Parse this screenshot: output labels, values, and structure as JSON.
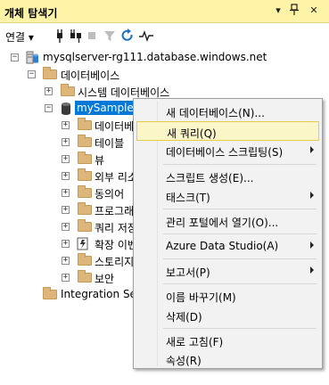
{
  "window": {
    "title": "개체 탐색기",
    "pin_glyph": "▾",
    "autohide_glyph": "ᚆ",
    "close_glyph": "✕"
  },
  "toolbar": {
    "connect_label": "연결",
    "tools": [
      "connect-plug-icon",
      "disconnect-plug-icon",
      "stop-icon",
      "filter-icon",
      "refresh-icon",
      "activity-monitor-icon"
    ]
  },
  "tree": {
    "server": "mysqlserver-rg111.database.windows.net",
    "databases_folder": "데이터베이스",
    "system_databases": "시스템 데이터베이스",
    "selected_db": "mySampleD",
    "children": [
      "데이터베이",
      "테이블",
      "뷰",
      "외부 리소",
      "동의어",
      "프로그래밍",
      "쿼리 저장",
      "확장 이벤",
      "스토리지",
      "보안"
    ],
    "integration": "Integration Servi"
  },
  "context_menu": {
    "items": [
      {
        "label": "새 데이터베이스(N)...",
        "submenu": false
      },
      {
        "label": "새 쿼리(Q)",
        "submenu": false,
        "highlighted": true
      },
      {
        "label": "데이터베이스 스크립팅(S)",
        "submenu": true
      },
      {
        "label": "스크립트 생성(E)...",
        "submenu": false
      },
      {
        "label": "태스크(T)",
        "submenu": true
      },
      {
        "label": "관리 포털에서 열기(O)...",
        "submenu": false
      },
      {
        "label": "Azure Data Studio(A)",
        "submenu": true
      },
      {
        "label": "보고서(P)",
        "submenu": true
      },
      {
        "label": "이름 바꾸기(M)",
        "submenu": false
      },
      {
        "label": "삭제(D)",
        "submenu": false
      },
      {
        "label": "새로 고침(F)",
        "submenu": false
      },
      {
        "label": "속성(R)",
        "submenu": false
      }
    ]
  },
  "colors": {
    "titlebar": "#fff3a8",
    "selection": "#0078d7",
    "highlight": "#fbf6c8",
    "folder": "#dcb67a"
  }
}
